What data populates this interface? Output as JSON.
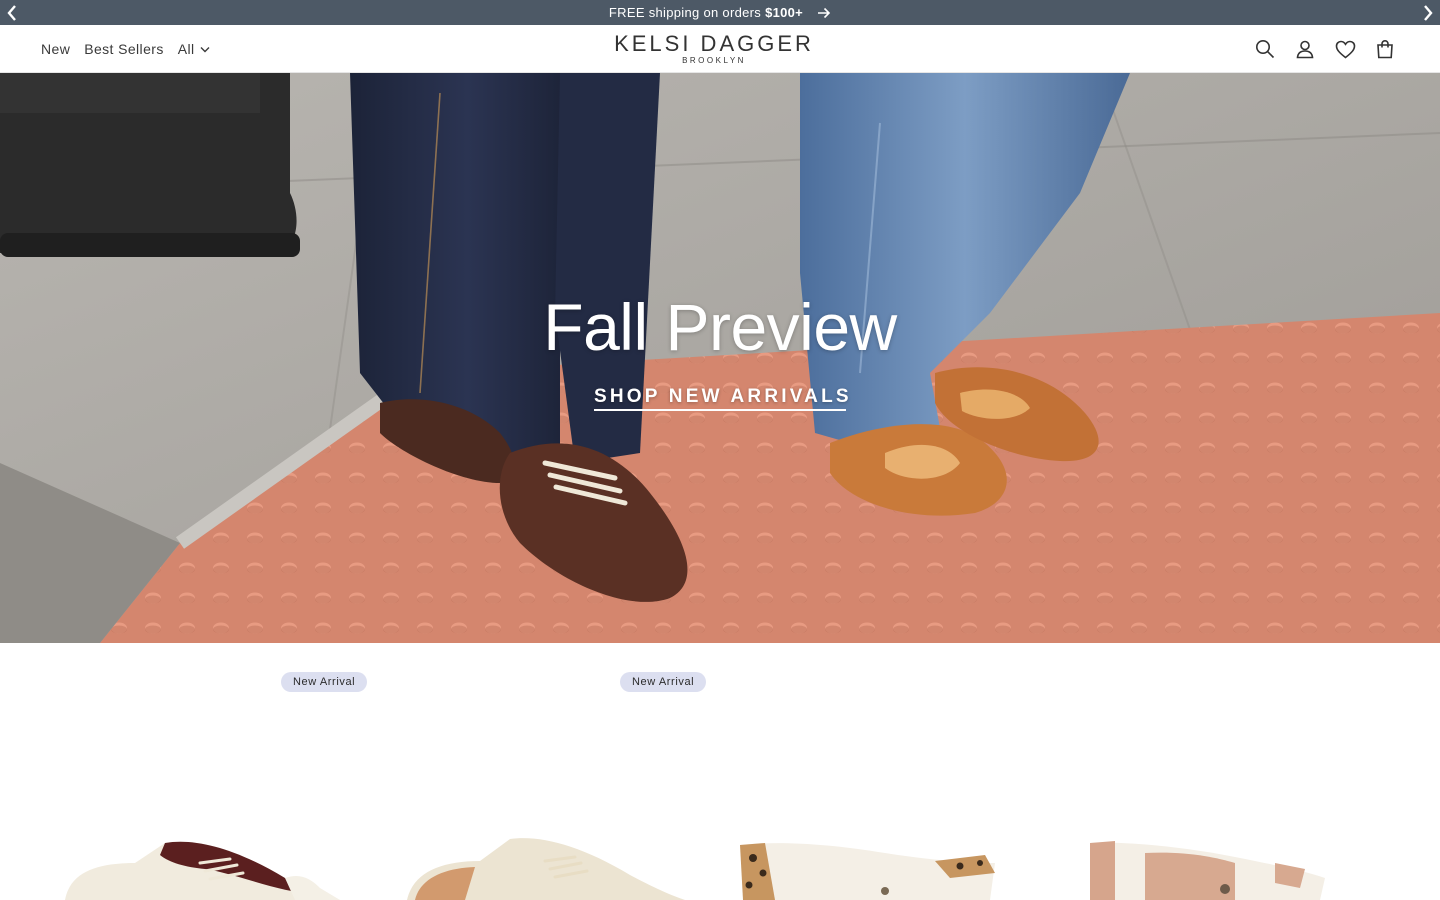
{
  "announcement": {
    "text": "FREE shipping on orders",
    "amount": "$100+",
    "prev_icon": "chevron-left-icon",
    "next_icon": "chevron-right-icon",
    "arrow_icon": "arrow-right-icon"
  },
  "header": {
    "nav": [
      {
        "label": "New"
      },
      {
        "label": "Best Sellers"
      },
      {
        "label": "All"
      }
    ],
    "logo": {
      "main": "KELSI DAGGER",
      "sub": "BROOKLYN"
    },
    "icons": [
      "search-icon",
      "account-icon",
      "wishlist-heart-icon",
      "cart-bag-icon"
    ]
  },
  "hero": {
    "title": "Fall Preview",
    "cta": "SHOP NEW ARRIVALS"
  },
  "products": {
    "badges": [
      "New Arrival",
      "New Arrival"
    ]
  },
  "colors": {
    "announcement_bg": "#4d5966",
    "badge_bg": "#dcdff0",
    "text": "#2b2b2b"
  }
}
